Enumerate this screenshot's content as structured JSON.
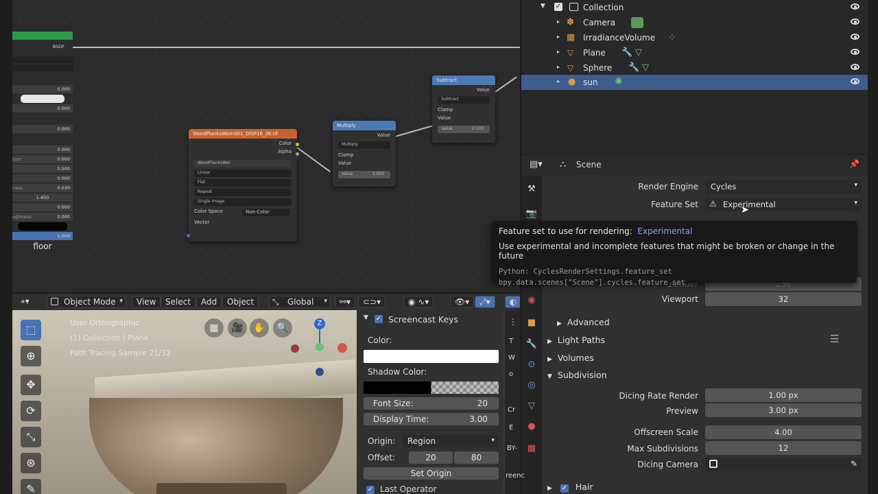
{
  "node_editor": {
    "bsdf_label": "BSDF",
    "material_panel": {
      "rows": [
        {
          "label": "",
          "value": "0.000"
        },
        {
          "label": "",
          "value": "0.000"
        },
        {
          "label": "",
          "value": "0.000"
        },
        {
          "label": "",
          "value": "0.000"
        },
        {
          "label": "tion:",
          "value": "0.000"
        },
        {
          "label": "",
          "value": "0.500"
        },
        {
          "label": "",
          "value": "0.000"
        },
        {
          "label": "ness:",
          "value": "0.030"
        },
        {
          "label": "",
          "value": "1.450"
        },
        {
          "label": "",
          "value": "0.000"
        },
        {
          "label": "ughness:",
          "value": "0.000"
        }
      ],
      "bottom_value": "1.000",
      "material_name": "floor"
    },
    "image_node": {
      "title": "WoodPlanksWorn001_DISP16_3K.tif",
      "out_color": "Color",
      "out_alpha": "Alpha",
      "image_name": "WoodPlanksWor",
      "interpolation": "Linear",
      "projection": "Flat",
      "extension": "Repeat",
      "source": "Single Image",
      "color_space_label": "Color Space",
      "color_space": "Non-Color",
      "in_vector": "Vector"
    },
    "multiply_node": {
      "title": "Multiply",
      "out_value": "Value",
      "operation": "Multiply",
      "clamp": "Clamp",
      "in_value": "Value",
      "value_label": "Value",
      "value": "1.000"
    },
    "subtract_node": {
      "title": "Subtract",
      "out_value": "Value",
      "operation": "Subtract",
      "clamp": "Clamp",
      "in_value": "Value",
      "value_label": "Value",
      "value": "0.100"
    }
  },
  "outliner": {
    "collection": "Collection",
    "items": [
      {
        "name": "Camera"
      },
      {
        "name": "IrradianceVolume"
      },
      {
        "name": "Plane"
      },
      {
        "name": "Sphere"
      },
      {
        "name": "sun"
      }
    ]
  },
  "properties": {
    "context": "Scene",
    "render_engine_label": "Render Engine",
    "render_engine": "Cycles",
    "feature_set_label": "Feature Set",
    "feature_set": "Experimental",
    "render_label": "Render",
    "render_value": "256",
    "viewport_label": "Viewport",
    "viewport_value": "32",
    "sections": {
      "advanced": "Advanced",
      "light_paths": "Light Paths",
      "volumes": "Volumes",
      "subdivision": "Subdivision",
      "hair": "Hair"
    },
    "subdivision": {
      "dicing_rate_render_label": "Dicing Rate Render",
      "dicing_rate_render": "1.00 px",
      "preview_label": "Preview",
      "preview": "3.00 px",
      "offscreen_scale_label": "Offscreen Scale",
      "offscreen_scale": "4.00",
      "max_subdivisions_label": "Max Subdivisions",
      "max_subdivisions": "12",
      "dicing_camera_label": "Dicing Camera"
    }
  },
  "tooltip": {
    "title": "Feature set to use for rendering:",
    "value": "Experimental",
    "description": "Use experimental and incomplete features that might be broken or change in the future",
    "python": "Python: CyclesRenderSettings.feature_set",
    "path": "bpy.data.scenes[\"Scene\"].cycles.feature_set"
  },
  "viewport": {
    "mode": "Object Mode",
    "menu": [
      "View",
      "Select",
      "Add",
      "Object"
    ],
    "orientation": "Global",
    "overlay_line1": "User Orthographic",
    "overlay_line2": "(1) Collection | Plane",
    "overlay_line3": "Path Tracing Sample 21/32",
    "gizmo_z": "Z"
  },
  "screencast_panel": {
    "title": "Screencast Keys",
    "color_label": "Color:",
    "shadow_color_label": "Shadow Color:",
    "font_size_label": "Font Size:",
    "font_size": "20",
    "display_time_label": "Display Time:",
    "display_time": "3.00",
    "origin_label": "Origin:",
    "origin": "Region",
    "offset_label": "Offset:",
    "offset_x": "20",
    "offset_y": "80",
    "set_origin": "Set Origin",
    "last_operator": "Last Operator",
    "side_tabs": [
      "T",
      "W",
      "o",
      "Cr",
      "E",
      "BY-",
      "reenc"
    ]
  },
  "colors": {
    "selection": "#3d5d8f",
    "accent": "#4772b3",
    "image_node_header": "#c8622c",
    "math_node_header": "#4a7bb5"
  }
}
